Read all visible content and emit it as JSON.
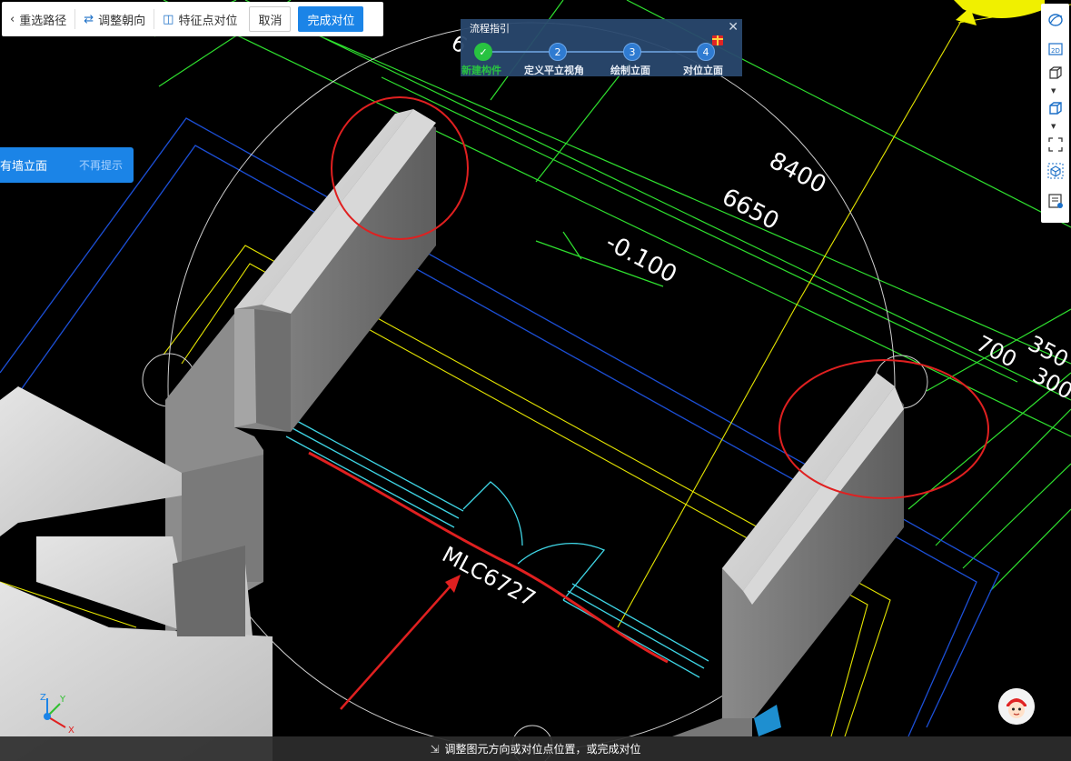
{
  "toolbar": {
    "reselect_label": "重选路径",
    "adjust_label": "调整朝向",
    "feature_label": "特征点对位",
    "cancel_label": "取消",
    "finish_label": "完成对位"
  },
  "flow": {
    "title": "流程指引",
    "steps": [
      {
        "num": "",
        "label": "新建构件",
        "status": "done"
      },
      {
        "num": "2",
        "label": "定义平立视角",
        "status": "pending"
      },
      {
        "num": "3",
        "label": "绘制立面",
        "status": "pending"
      },
      {
        "num": "4",
        "label": "对位立面",
        "status": "pending"
      }
    ]
  },
  "hint": {
    "text": "有墙立面",
    "dismiss": "不再提示"
  },
  "canvas": {
    "dimensions": [
      "8400",
      "6650",
      "-0.100",
      "700",
      "350",
      "300",
      "6"
    ],
    "door_label": "MLC6727"
  },
  "right_toolbar": {
    "items": [
      "orbit-icon",
      "2d-view-icon",
      "3d-box-icon",
      "3d-box-solid-icon",
      "fullscreen-icon",
      "cube-view-icon",
      "layer-list-icon"
    ],
    "two_d_label": "2D"
  },
  "status": {
    "text": "调整图元方向或对位点位置，或完成对位"
  },
  "axis": {
    "x": "X",
    "y": "Y",
    "z": "Z"
  },
  "colors": {
    "accent": "#1b84e7",
    "done": "#28c341",
    "highlight_circle": "#e02020",
    "dim_line": "#2fe02f",
    "axis_line": "#e6e600",
    "blue_line": "#1c4fd6",
    "cyan_line": "#3fd6e6"
  }
}
